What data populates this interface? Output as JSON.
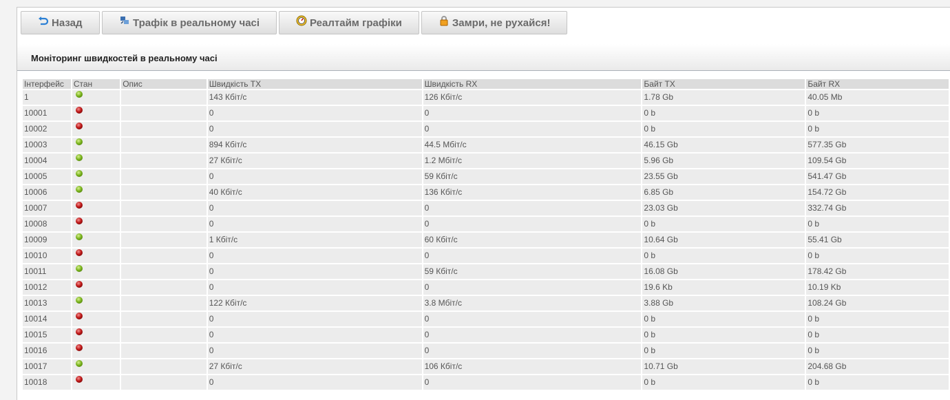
{
  "toolbar": {
    "back_label": "Назад",
    "traffic_label": "Трафік в реальному часі",
    "charts_label": "Реалтайм графіки",
    "freeze_label": "Замри, не рухайся!"
  },
  "header": {
    "title": "Моніторинг швидкостей в реальному часі"
  },
  "table": {
    "columns": [
      "Інтерфейс",
      "Стан",
      "Опис",
      "Швидкість TX",
      "Швидкість RX",
      "Байт TX",
      "Байт RX"
    ],
    "rows": [
      {
        "iface": "1",
        "state": "up",
        "desc": "",
        "tx": "143 Кбіт/с",
        "rx": "126 Кбіт/с",
        "btx": "1.78 Gb",
        "brx": "40.05 Mb"
      },
      {
        "iface": "10001",
        "state": "down",
        "desc": "",
        "tx": "0",
        "rx": "0",
        "btx": "0 b",
        "brx": "0 b"
      },
      {
        "iface": "10002",
        "state": "down",
        "desc": "",
        "tx": "0",
        "rx": "0",
        "btx": "0 b",
        "brx": "0 b"
      },
      {
        "iface": "10003",
        "state": "up",
        "desc": "",
        "tx": "894 Кбіт/с",
        "rx": "44.5 Мбіт/с",
        "btx": "46.15 Gb",
        "brx": "577.35 Gb"
      },
      {
        "iface": "10004",
        "state": "up",
        "desc": "",
        "tx": "27 Кбіт/с",
        "rx": "1.2 Мбіт/с",
        "btx": "5.96 Gb",
        "brx": "109.54 Gb"
      },
      {
        "iface": "10005",
        "state": "up",
        "desc": "",
        "tx": "0",
        "rx": "59 Кбіт/с",
        "btx": "23.55 Gb",
        "brx": "541.47 Gb"
      },
      {
        "iface": "10006",
        "state": "up",
        "desc": "",
        "tx": "40 Кбіт/с",
        "rx": "136 Кбіт/с",
        "btx": "6.85 Gb",
        "brx": "154.72 Gb"
      },
      {
        "iface": "10007",
        "state": "down",
        "desc": "",
        "tx": "0",
        "rx": "0",
        "btx": "23.03 Gb",
        "brx": "332.74 Gb"
      },
      {
        "iface": "10008",
        "state": "down",
        "desc": "",
        "tx": "0",
        "rx": "0",
        "btx": "0 b",
        "brx": "0 b"
      },
      {
        "iface": "10009",
        "state": "up",
        "desc": "",
        "tx": "1 Кбіт/с",
        "rx": "60 Кбіт/с",
        "btx": "10.64 Gb",
        "brx": "55.41 Gb"
      },
      {
        "iface": "10010",
        "state": "down",
        "desc": "",
        "tx": "0",
        "rx": "0",
        "btx": "0 b",
        "brx": "0 b"
      },
      {
        "iface": "10011",
        "state": "up",
        "desc": "",
        "tx": "0",
        "rx": "59 Кбіт/с",
        "btx": "16.08 Gb",
        "brx": "178.42 Gb"
      },
      {
        "iface": "10012",
        "state": "down",
        "desc": "",
        "tx": "0",
        "rx": "0",
        "btx": "19.6 Kb",
        "brx": "10.19 Kb"
      },
      {
        "iface": "10013",
        "state": "up",
        "desc": "",
        "tx": "122 Кбіт/с",
        "rx": "3.8 Мбіт/с",
        "btx": "3.88 Gb",
        "brx": "108.24 Gb"
      },
      {
        "iface": "10014",
        "state": "down",
        "desc": "",
        "tx": "0",
        "rx": "0",
        "btx": "0 b",
        "brx": "0 b"
      },
      {
        "iface": "10015",
        "state": "down",
        "desc": "",
        "tx": "0",
        "rx": "0",
        "btx": "0 b",
        "brx": "0 b"
      },
      {
        "iface": "10016",
        "state": "down",
        "desc": "",
        "tx": "0",
        "rx": "0",
        "btx": "0 b",
        "brx": "0 b"
      },
      {
        "iface": "10017",
        "state": "up",
        "desc": "",
        "tx": "27 Кбіт/с",
        "rx": "106 Кбіт/с",
        "btx": "10.71 Gb",
        "brx": "204.68 Gb"
      },
      {
        "iface": "10018",
        "state": "down",
        "desc": "",
        "tx": "0",
        "rx": "0",
        "btx": "0 b",
        "brx": "0 b"
      }
    ]
  },
  "colors": {
    "status_up": "#7cb520",
    "status_down": "#c01818",
    "header_bg": "#dcdcdc",
    "row_bg": "#ececec"
  },
  "icons": {
    "back": "back-arrow-icon",
    "traffic": "network-icon",
    "charts": "gauge-icon",
    "freeze": "lock-icon"
  }
}
